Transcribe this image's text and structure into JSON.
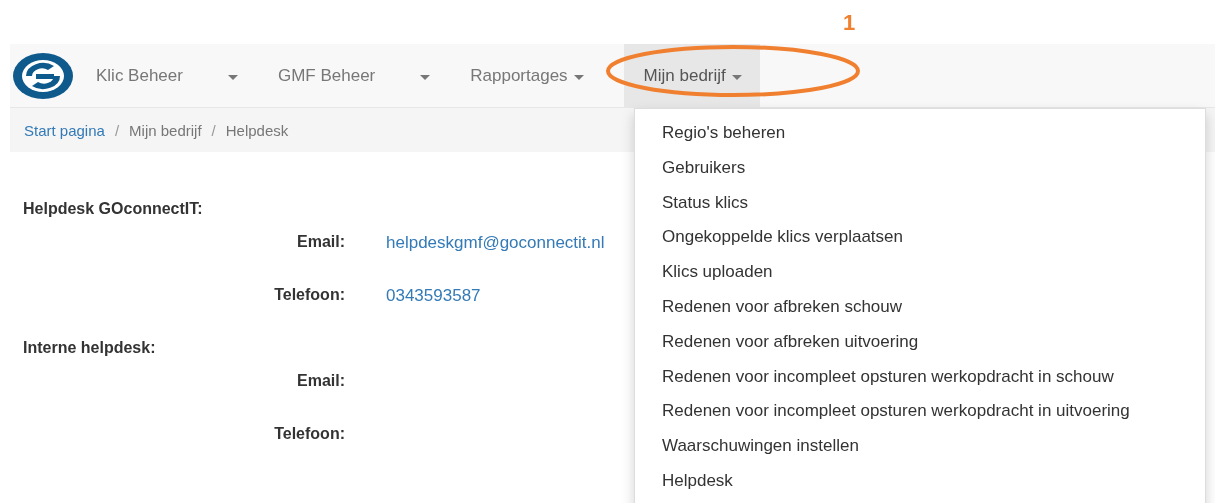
{
  "annotation": {
    "label": "1"
  },
  "navbar": {
    "items": [
      {
        "label": "Klic Beheer",
        "selected": false
      },
      {
        "label": "GMF Beheer",
        "selected": false
      },
      {
        "label": "Rapportages",
        "selected": false
      },
      {
        "label": "Mijn bedrijf",
        "selected": true
      }
    ]
  },
  "breadcrumb": [
    {
      "label": "Start pagina",
      "kind": "link"
    },
    {
      "label": "Mijn bedrijf",
      "kind": "text",
      "separator": "/"
    },
    {
      "label": "Helpdesk",
      "kind": "text",
      "separator": "/"
    }
  ],
  "sections": [
    {
      "title": "Helpdesk GOconnectIT:",
      "rows": [
        {
          "label": "Email:",
          "value": "helpdeskgmf@goconnectit.nl"
        },
        {
          "label": "Telefoon:",
          "value": "0343593587"
        }
      ]
    },
    {
      "title": "Interne helpdesk:",
      "rows": [
        {
          "label": "Email:"
        },
        {
          "label": "Telefoon:"
        }
      ]
    }
  ],
  "dropdown": {
    "items": [
      "Regio's beheren",
      "Gebruikers",
      "Status klics",
      "Ongekoppelde klics verplaatsen",
      "Klics uploaden",
      "Redenen voor afbreken schouw",
      "Redenen voor afbreken uitvoering",
      "Redenen voor incompleet opsturen werkopdracht in schouw",
      "Redenen voor incompleet opsturen werkopdracht in uitvoering",
      "Waarschuwingen instellen",
      "Helpdesk"
    ]
  }
}
